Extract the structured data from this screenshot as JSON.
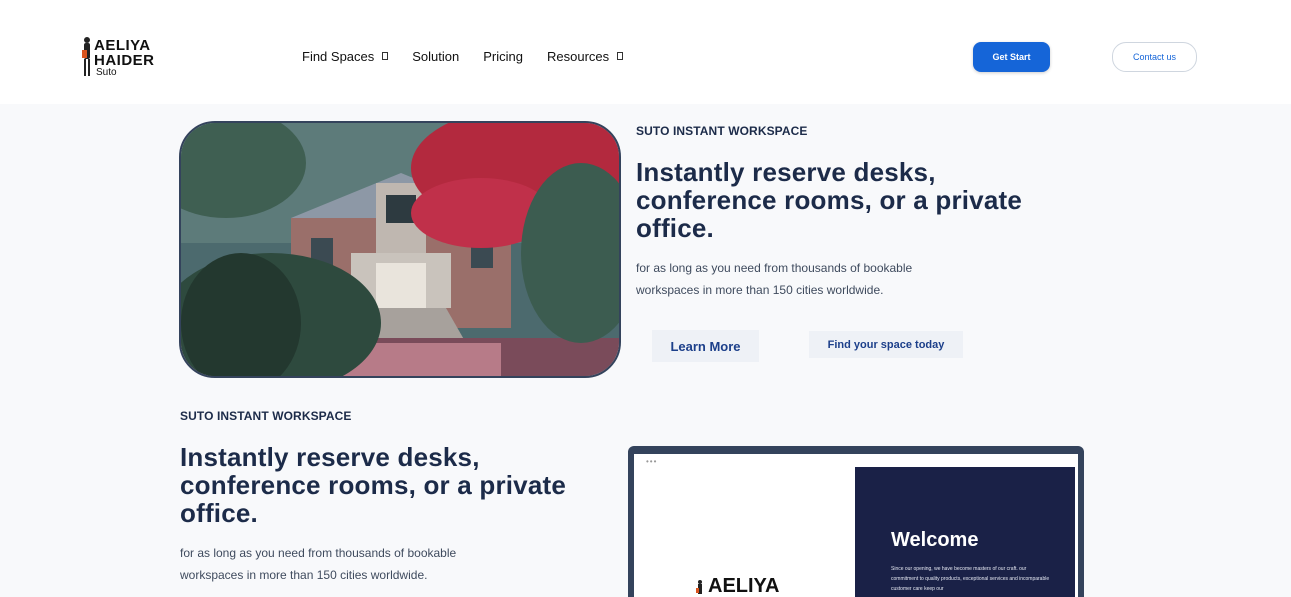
{
  "brand": {
    "line1": "AELIYA",
    "line2": "HAIDER",
    "sub": "Suto"
  },
  "nav": [
    {
      "label": "Find Spaces",
      "has_dropdown": true
    },
    {
      "label": "Solution",
      "has_dropdown": false
    },
    {
      "label": "Pricing",
      "has_dropdown": false
    },
    {
      "label": "Resources",
      "has_dropdown": true
    }
  ],
  "header": {
    "start_label": "Get Start",
    "contact_label": "Contact us"
  },
  "hero1": {
    "eyebrow": "SUTO INSTANT WORKSPACE",
    "headline_l1": "Instantly reserve desks,",
    "headline_l2": "conference rooms, or a private",
    "headline_l3": "office.",
    "para_l1": "for as long as you need from thousands of bookable",
    "para_l2": "workspaces in more than 150 cities worldwide.",
    "learn_label": "Learn More",
    "find_label": "Find your space today"
  },
  "hero2": {
    "eyebrow": "SUTO INSTANT WORKSPACE",
    "headline_l1": "Instantly reserve desks,",
    "headline_l2": "conference rooms, or a private",
    "headline_l3": "office.",
    "para_l1": "for as long as you need from thousands of bookable",
    "para_l2": "workspaces in more than 150 cities worldwide."
  },
  "laptop": {
    "dots": "•••",
    "logo": "AELIYA",
    "welcome": "Welcome",
    "welcome_text": "Since our opening, we have become masters of our craft. our commitment to quality products, exceptional services and incomparable customer care keep our"
  },
  "colors": {
    "accent": "#1565d8",
    "navy": "#1c2b49",
    "laptop_frame": "#34435c",
    "laptop_panel": "#1a2147"
  }
}
